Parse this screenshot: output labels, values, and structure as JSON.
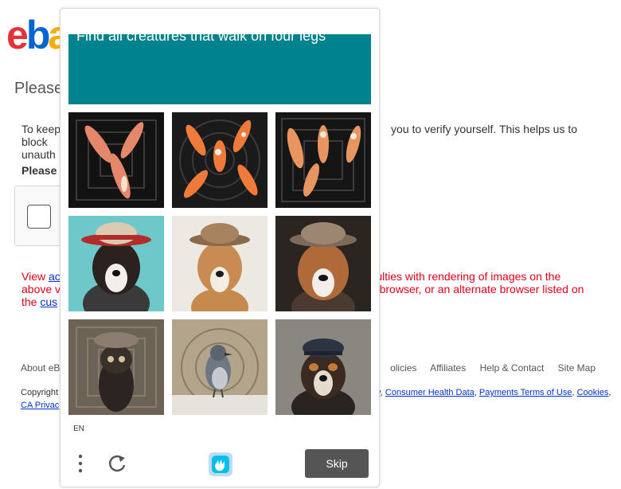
{
  "page": {
    "logo_parts": [
      "e",
      "b",
      "a"
    ],
    "heading": "Please",
    "para_left": "To keep",
    "para_right": "you to verify yourself. This helps us to block",
    "para_line2": "unauth",
    "please_bold": "Please",
    "red_line1_left": "View",
    "red_link": "ac",
    "red_line1_right": "difficulties with rendering of images on the",
    "red_line2_left": "above v",
    "red_line2_right": "r browser, or an alternate browser listed on",
    "red_line3_left": "the",
    "red_line3_link": "cus",
    "footer_links": [
      "About eB",
      "olicies",
      "Affiliates",
      "Help & Contact",
      "Site Map"
    ],
    "copyright_left": "Copyright",
    "copyright_links": [
      "y",
      "Consumer Health Data",
      "Payments Terms of Use",
      "Cookies"
    ],
    "privacy_link": "CA Privac"
  },
  "challenge": {
    "prompt": "Find all creatures that walk on four legs",
    "language": "EN",
    "skip_label": "Skip",
    "banner_color": "#00838f",
    "icons": [
      "menu-dots-icon",
      "refresh-icon",
      "hcaptcha-logo-icon"
    ],
    "tiles": [
      "koi-fish",
      "koi-fish",
      "koi-fish",
      "dog-red-hat",
      "dog-tan-hat",
      "dog-brown-hat",
      "owl-hat",
      "bird-on-branch",
      "dog-cap"
    ]
  }
}
